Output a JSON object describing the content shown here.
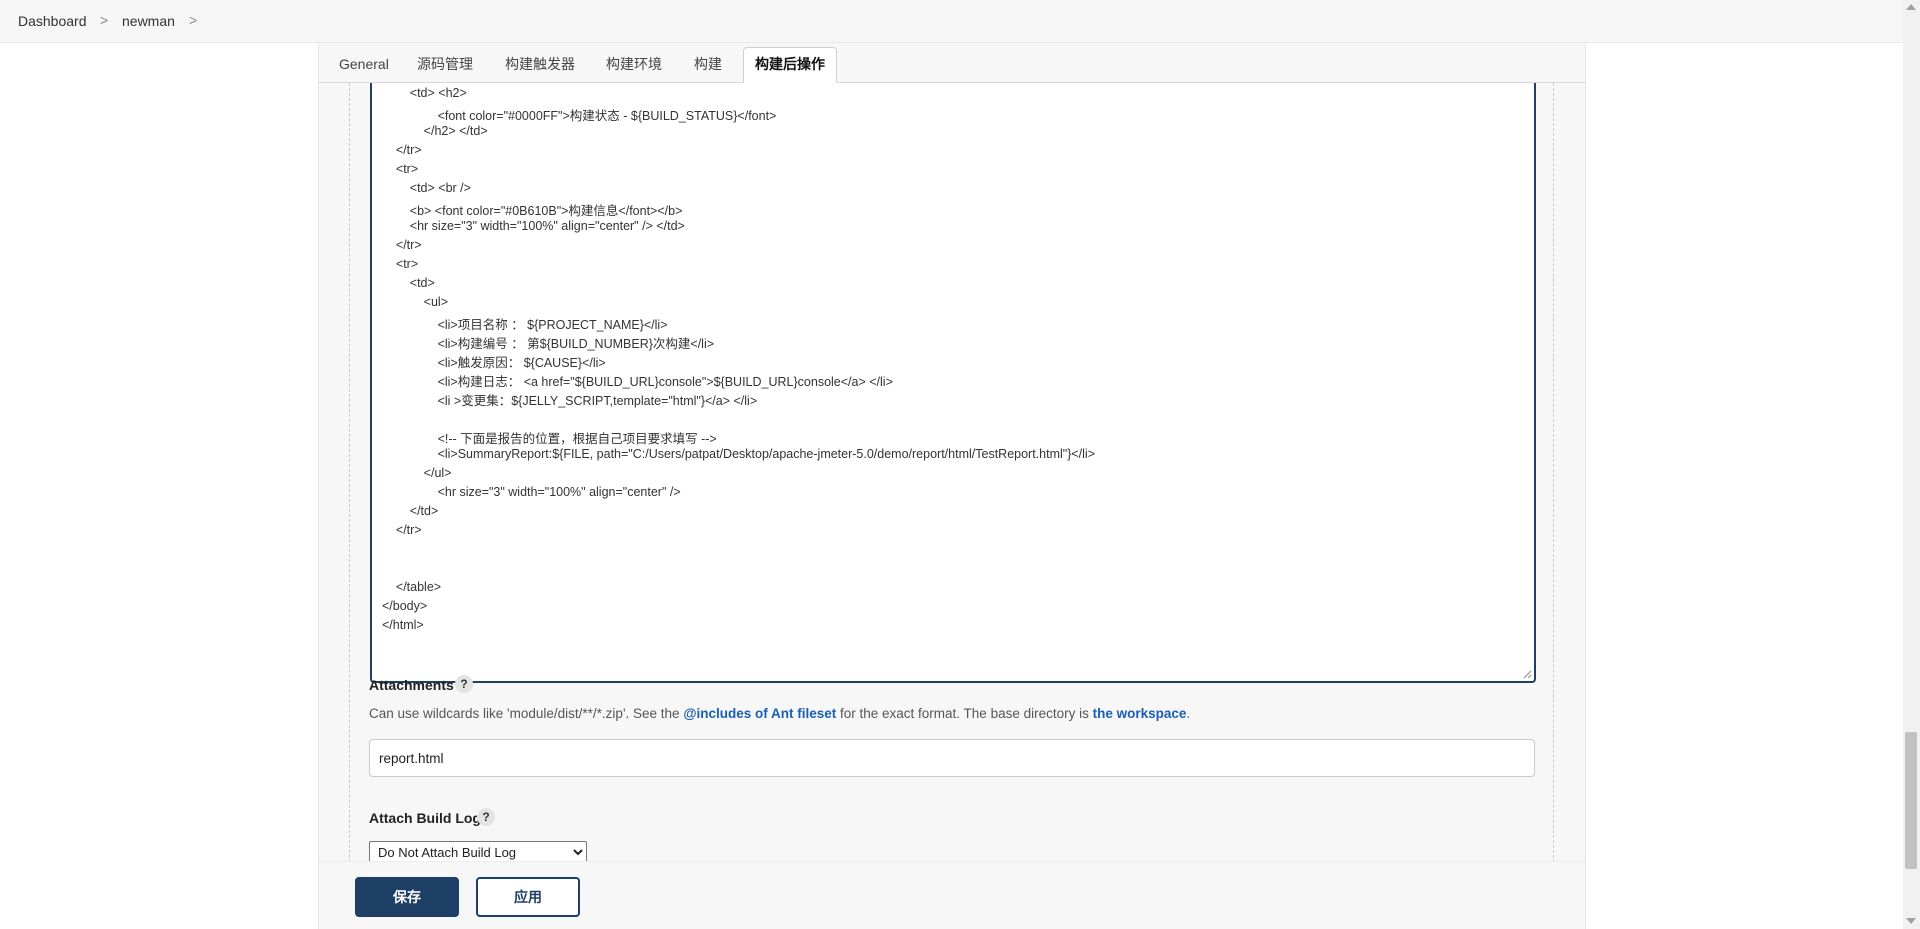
{
  "breadcrumb": {
    "items": [
      "Dashboard",
      "newman"
    ],
    "separator": ">"
  },
  "tabs": [
    {
      "label": "General",
      "active": false
    },
    {
      "label": "源码管理",
      "active": false
    },
    {
      "label": "构建触发器",
      "active": false
    },
    {
      "label": "构建环境",
      "active": false
    },
    {
      "label": "构建",
      "active": false
    },
    {
      "label": "构建后操作",
      "active": true
    }
  ],
  "editor": {
    "lines": [
      "        <td> <h2>",
      "                <font color=\"#0000FF\">构建状态 - ${BUILD_STATUS}</font>",
      "            </h2> </td>",
      "    </tr>",
      "    <tr>",
      "        <td> <br />",
      "        <b> <font color=\"#0B610B\">构建信息</font></b>",
      "        <hr size=\"3\" width=\"100%\" align=\"center\" /> </td>",
      "    </tr>",
      "    <tr>",
      "        <td>",
      "            <ul>",
      "                <li>项目名称 ： ${PROJECT_NAME}</li>",
      "                <li>构建编号 ： 第${BUILD_NUMBER}次构建</li>",
      "                <li>触发原因： ${CAUSE}</li>",
      "                <li>构建日志： <a href=\"${BUILD_URL}console\">${BUILD_URL}console</a> </li>",
      "                <li >变更集：${JELLY_SCRIPT,template=\"html\"}</a> </li>",
      "",
      "                <!-- 下面是报告的位置，根据自己项目要求填写 -->",
      "                <li>SummaryReport:${FILE, path=\"C:/Users/patpat/Desktop/apache-jmeter-5.0/demo/report/html/TestReport.html\"}</li>",
      "            </ul>",
      "                <hr size=\"3\" width=\"100%\" align=\"center\" />",
      "        </td>",
      "    </tr>",
      "",
      "",
      "    </table>",
      "</body>",
      "</html>"
    ]
  },
  "attachments": {
    "label": "Attachments",
    "help": "?",
    "desc_prefix": "Can use wildcards like 'module/dist/**/*.zip'. See the ",
    "desc_link1": "@includes of Ant fileset",
    "desc_middle": " for the exact format. The base directory is ",
    "desc_link2": "the workspace",
    "desc_suffix": ".",
    "value": "report.html"
  },
  "attach_build_log": {
    "label": "Attach Build Log",
    "help": "?",
    "selected": "Do Not Attach Build Log"
  },
  "actions": {
    "save": "保存",
    "apply": "应用"
  }
}
